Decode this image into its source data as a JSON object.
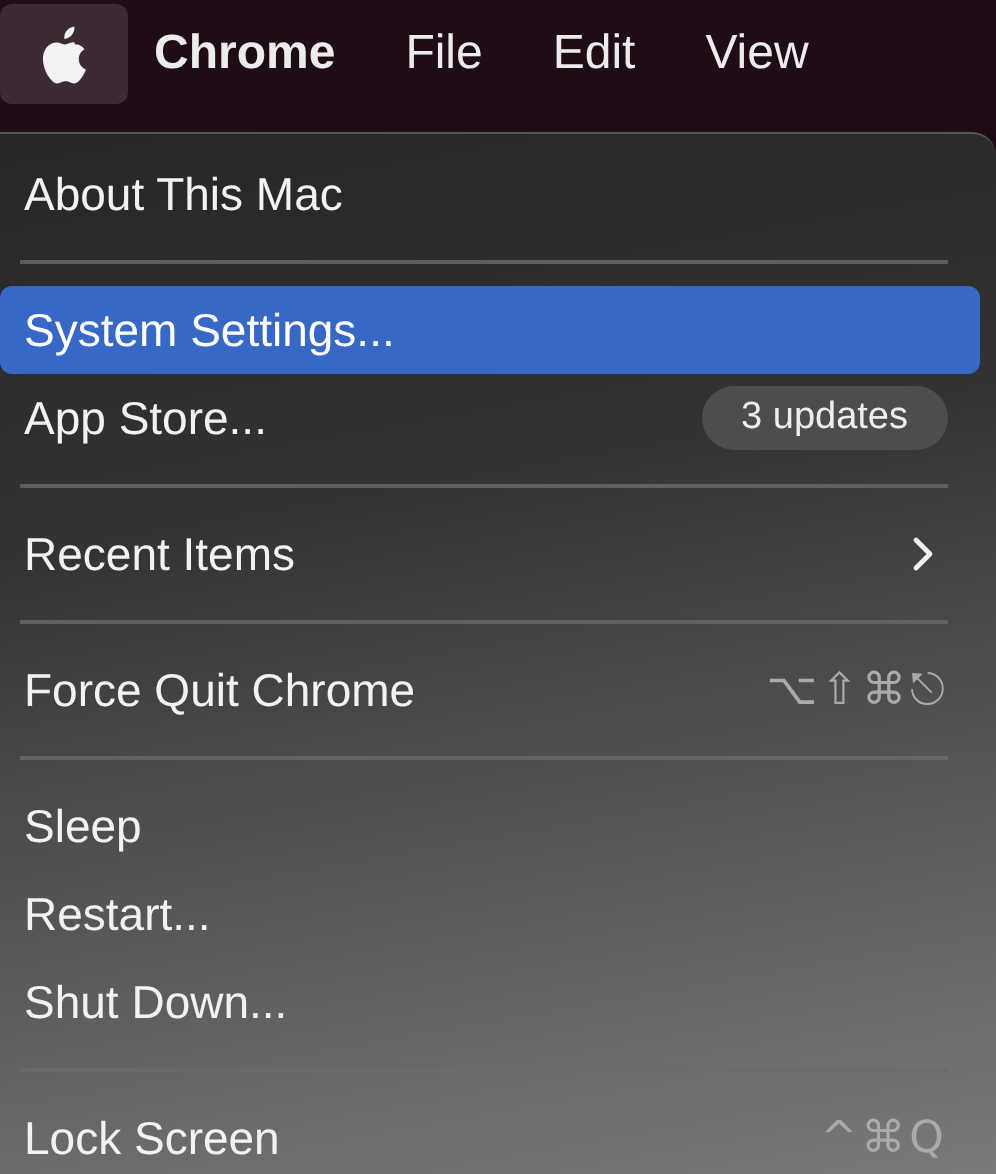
{
  "menu_bar": {
    "apple_selected": true,
    "items": [
      {
        "label": "Chrome",
        "bold": true
      },
      {
        "label": "File",
        "bold": false
      },
      {
        "label": "Edit",
        "bold": false
      },
      {
        "label": "View",
        "bold": false
      }
    ]
  },
  "menu": {
    "items": [
      {
        "kind": "item",
        "label": "About This Mac",
        "selected": false
      },
      {
        "kind": "separator"
      },
      {
        "kind": "item",
        "label": "System Settings...",
        "selected": true
      },
      {
        "kind": "item",
        "label": "App Store...",
        "selected": false,
        "badge": "3 updates"
      },
      {
        "kind": "separator"
      },
      {
        "kind": "item",
        "label": "Recent Items",
        "selected": false,
        "submenu": true
      },
      {
        "kind": "separator"
      },
      {
        "kind": "item",
        "label": "Force Quit Chrome",
        "selected": false,
        "shortcut": "⌥⇧⌘⎋"
      },
      {
        "kind": "separator"
      },
      {
        "kind": "item",
        "label": "Sleep",
        "selected": false
      },
      {
        "kind": "item",
        "label": "Restart...",
        "selected": false
      },
      {
        "kind": "item",
        "label": "Shut Down...",
        "selected": false
      },
      {
        "kind": "separator"
      },
      {
        "kind": "item",
        "label": "Lock Screen",
        "selected": false,
        "shortcut": "^⌘Q"
      }
    ]
  }
}
